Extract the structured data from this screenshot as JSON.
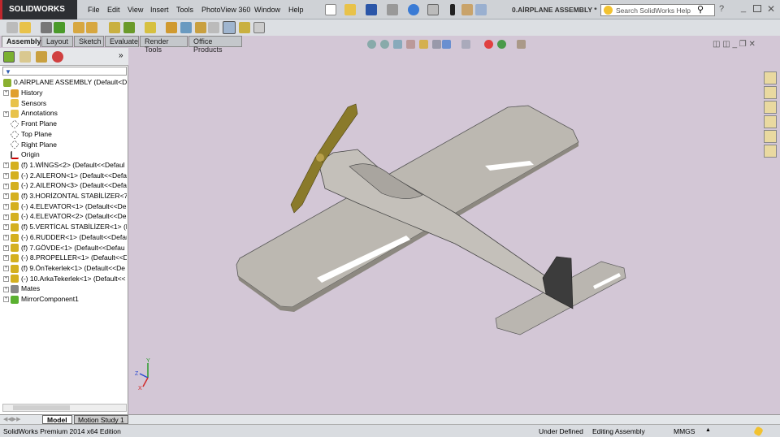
{
  "app": {
    "logo": "SOLIDWORKS",
    "title": "0.AİRPLANE ASSEMBLY *"
  },
  "menu": [
    "File",
    "Edit",
    "View",
    "Insert",
    "Tools",
    "PhotoView 360",
    "Window",
    "Help"
  ],
  "search": {
    "placeholder": "Search SolidWorks Help"
  },
  "tabs": [
    "Assembly",
    "Layout",
    "Sketch",
    "Evaluate",
    "Render Tools",
    "Office Products"
  ],
  "tree": {
    "root": "0.AİRPLANE ASSEMBLY  (Default<Def",
    "items": [
      {
        "label": "History",
        "icon": "history-icon",
        "expand": true
      },
      {
        "label": "Sensors",
        "icon": "sensors-icon",
        "expand": false
      },
      {
        "label": "Annotations",
        "icon": "annotations-icon",
        "expand": true
      },
      {
        "label": "Front Plane",
        "icon": "plane-icon",
        "expand": false
      },
      {
        "label": "Top Plane",
        "icon": "plane-icon",
        "expand": false
      },
      {
        "label": "Right Plane",
        "icon": "plane-icon",
        "expand": false
      },
      {
        "label": "Origin",
        "icon": "origin-icon",
        "expand": false
      },
      {
        "label": "(f) 1.WİNGS<2> (Default<<Defaul",
        "icon": "part-icon",
        "expand": true
      },
      {
        "label": "(-) 2.AILERON<1> (Default<<Defa",
        "icon": "part-icon",
        "expand": true
      },
      {
        "label": "(-) 2.AILERON<3> (Default<<Defa",
        "icon": "part-icon",
        "expand": true
      },
      {
        "label": "(f) 3.HORİZONTAL STABİLİZER<7:",
        "icon": "part-icon",
        "expand": true
      },
      {
        "label": "(-) 4.ELEVATOR<1> (Default<<De",
        "icon": "part-icon",
        "expand": true
      },
      {
        "label": "(-) 4.ELEVATOR<2> (Default<<De",
        "icon": "part-icon",
        "expand": true
      },
      {
        "label": "(f) 5.VERTİCAL STABİLİZER<1> (D",
        "icon": "part-icon",
        "expand": true
      },
      {
        "label": "(-) 6.RUDDER<1> (Default<<Defar",
        "icon": "part-icon",
        "expand": true
      },
      {
        "label": "(f) 7.GÖVDE<1> (Default<<Defau",
        "icon": "part-icon",
        "expand": true
      },
      {
        "label": "(-) 8.PROPELLER<1> (Default<<D",
        "icon": "part-icon",
        "expand": true
      },
      {
        "label": "(f) 9.ÖnTekerlek<1> (Default<<De",
        "icon": "part-icon",
        "expand": true
      },
      {
        "label": "(-) 10.ArkaTekerlek<1> (Default<<",
        "icon": "part-icon",
        "expand": true
      },
      {
        "label": "Mates",
        "icon": "mates-icon",
        "expand": true
      },
      {
        "label": "MirrorComponent1",
        "icon": "mirror-icon",
        "expand": true
      }
    ]
  },
  "bottom_tabs": [
    "Model",
    "Motion Study 1"
  ],
  "status": {
    "edition": "SolidWorks Premium 2014 x64 Edition",
    "state": "Under Defined",
    "mode": "Editing Assembly",
    "units": "MMGS"
  },
  "triad": {
    "x": "X",
    "y": "Y",
    "z": "Z"
  },
  "colors": {
    "viewport": "#d3c7d6",
    "model": "#b9b5ae",
    "propeller": "#8a7a2a"
  }
}
